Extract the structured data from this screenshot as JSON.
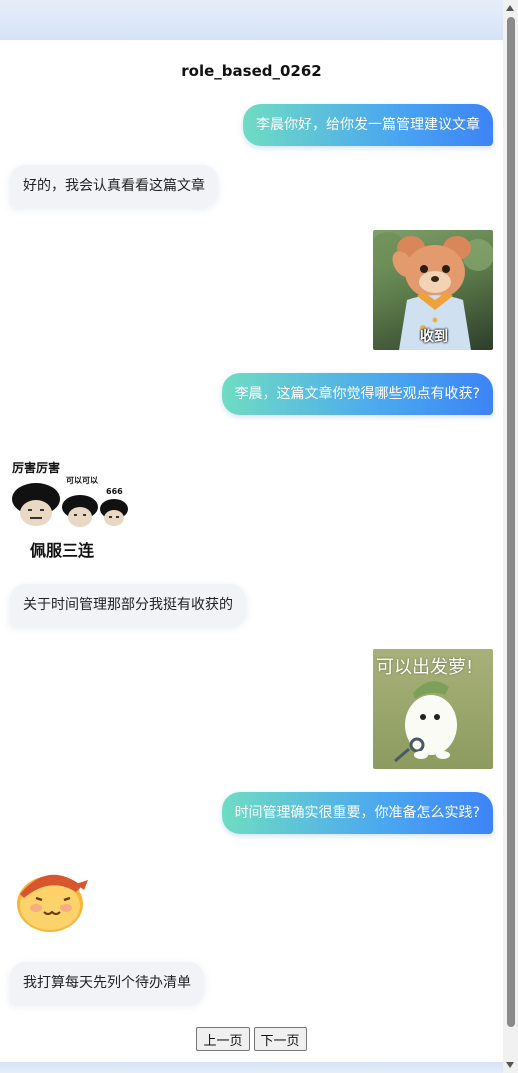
{
  "chat": {
    "title": "role_based_0262",
    "messages": [
      {
        "side": "right",
        "type": "text",
        "text": "李晨你好，给你发一篇管理建议文章"
      },
      {
        "side": "left",
        "type": "text",
        "text": "好的，我会认真看看这篇文章"
      },
      {
        "side": "right",
        "type": "sticker",
        "caption": "收到"
      },
      {
        "side": "right",
        "type": "text",
        "text": "李晨，这篇文章你觉得哪些观点有收获?"
      },
      {
        "side": "left",
        "type": "sticker",
        "caption_top": "厉害厉害",
        "caption_small1": "可以可以",
        "caption_small2": "666",
        "caption_bottom": "佩服三连"
      },
      {
        "side": "left",
        "type": "text",
        "text": "关于时间管理那部分我挺有收获的"
      },
      {
        "side": "right",
        "type": "sticker",
        "caption": "可以出发萝!"
      },
      {
        "side": "right",
        "type": "text",
        "text": "时间管理确实很重要，你准备怎么实践?"
      },
      {
        "side": "left",
        "type": "emoji"
      },
      {
        "side": "left",
        "type": "text",
        "text": "我打算每天先列个待办清单"
      }
    ]
  },
  "pager": {
    "prev_label": "上一页",
    "next_label": "下一页"
  },
  "colors": {
    "bubble_gradient_start": "#6fdcc3",
    "bubble_gradient_end": "#3d83f6",
    "left_bubble_bg": "#f1f3f7"
  }
}
